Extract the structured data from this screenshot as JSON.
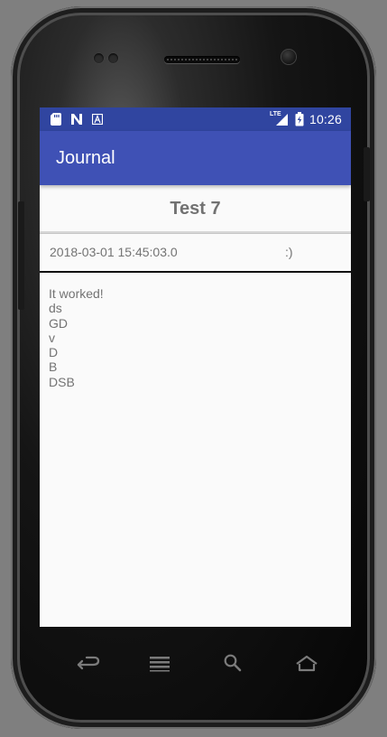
{
  "status_bar": {
    "time": "10:26",
    "icons": [
      "sd-card-icon",
      "n-icon",
      "a-icon",
      "signal-icon",
      "battery-icon"
    ],
    "network_label": "LTE"
  },
  "app_bar": {
    "title": "Journal"
  },
  "entry": {
    "title": "Test 7",
    "timestamp": "2018-03-01 15:45:03.0",
    "mood": ":)",
    "body_lines": [
      "It worked!",
      "ds",
      "GD",
      "v",
      "D",
      "B",
      "DSB"
    ]
  },
  "nav_bar": {
    "buttons": [
      "back-icon",
      "menu-icon",
      "search-icon",
      "home-icon"
    ]
  },
  "colors": {
    "status_bar": "#3045a0",
    "app_bar": "#3f51b5",
    "screen_bg": "#fafafa",
    "text_gray": "#737373"
  }
}
